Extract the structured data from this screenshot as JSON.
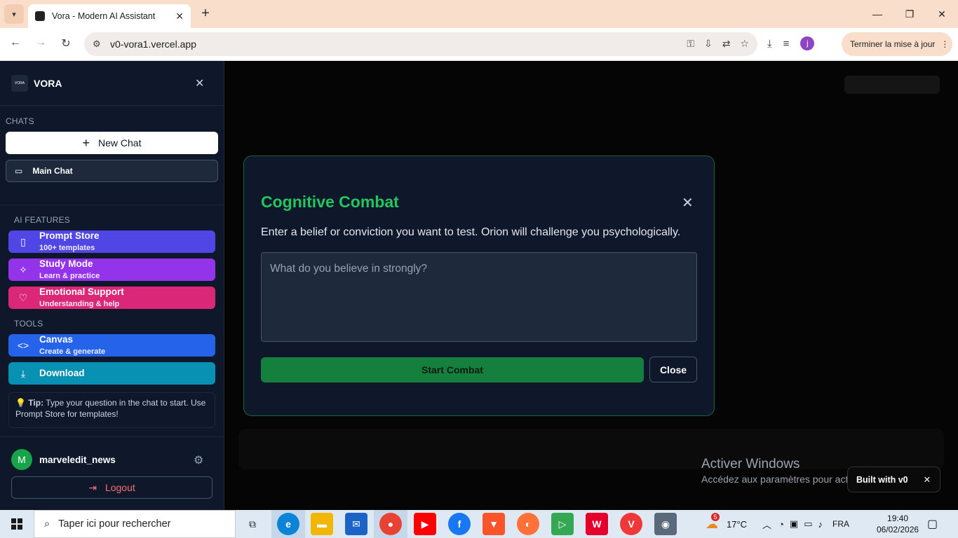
{
  "browser": {
    "tab_title": "Vora - Modern AI Assistant",
    "url": "v0-vora1.vercel.app",
    "update_label": "Terminer la mise à jour",
    "profile_initial": "j"
  },
  "sidebar": {
    "logo_label": "VORA",
    "logo_mark": "VORA",
    "chats_label": "CHATS",
    "new_chat_label": "New Chat",
    "main_chat_label": "Main Chat",
    "ai_features_label": "AI FEATURES",
    "features": [
      {
        "title": "Prompt Store",
        "subtitle": "100+ templates",
        "color": "#4f46e5",
        "icon": "book-icon"
      },
      {
        "title": "Study Mode",
        "subtitle": "Learn & practice",
        "color": "#9333ea",
        "icon": "sparkles-icon"
      },
      {
        "title": "Emotional Support",
        "subtitle": "Understanding & help",
        "color": "#db2777",
        "icon": "heart-icon"
      }
    ],
    "tools_label": "TOOLS",
    "tools": [
      {
        "title": "Canvas",
        "subtitle": "Create & generate",
        "color": "#2563eb",
        "icon": "code-icon"
      },
      {
        "title": "Download",
        "color": "#0891b2",
        "icon": "download-icon"
      }
    ],
    "tip_label": "Tip:",
    "tip_text": "Type your question in the chat to start. Use Prompt Store for templates!",
    "user": {
      "initial": "M",
      "name": "marveledit_news"
    },
    "logout_label": "Logout"
  },
  "modal": {
    "title": "Cognitive Combat",
    "description": "Enter a belief or conviction you want to test. Orion will challenge you psychologically.",
    "placeholder": "What do you believe in strongly?",
    "value": "",
    "start_label": "Start Combat",
    "close_label": "Close",
    "accent_color": "#22c55e"
  },
  "overlay": {
    "activate_title": "Activer Windows",
    "activate_sub": "Accédez aux paramètres pour activer Windows.",
    "built_with": "Built with v0"
  },
  "taskbar": {
    "search_placeholder": "Taper ici pour rechercher",
    "weather": "17°C",
    "weather_badge": "5",
    "language": "FRA",
    "time": "19:40",
    "date": "06/02/2026"
  }
}
